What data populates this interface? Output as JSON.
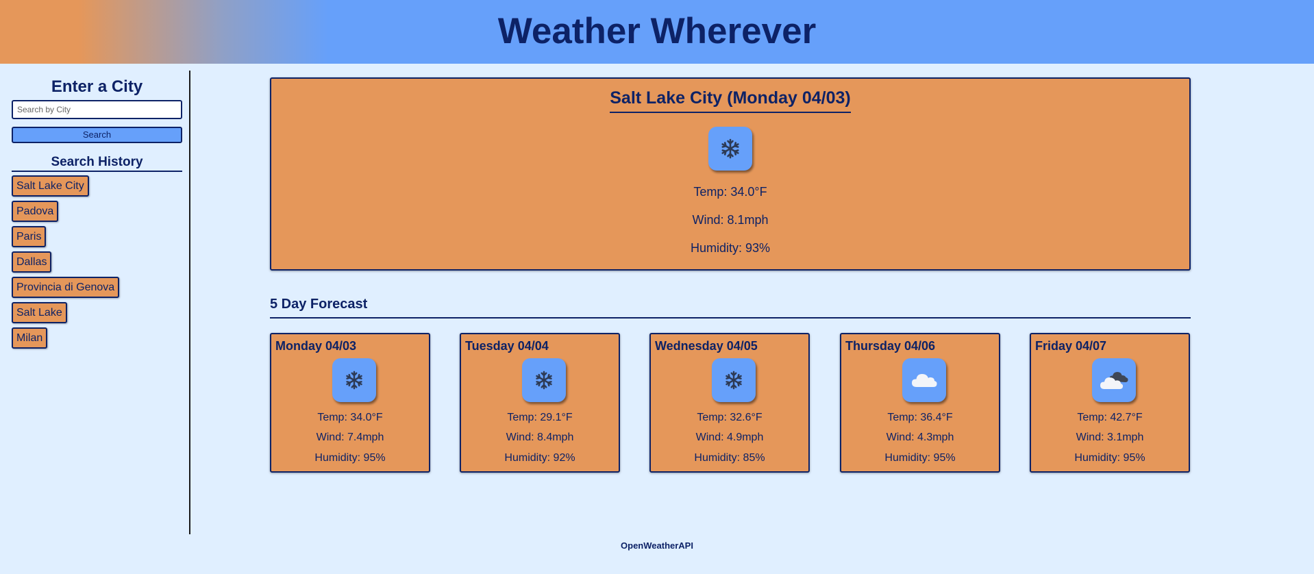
{
  "app": {
    "title": "Weather Wherever",
    "footer": "OpenWeatherAPI",
    "colors": {
      "accent_orange": "#e5975a",
      "accent_blue": "#66a0fa",
      "text_navy": "#0d2266",
      "background": "#e0efff"
    }
  },
  "sidebar": {
    "title": "Enter a City",
    "search_placeholder": "Search by City",
    "search_value": "",
    "search_button": "Search",
    "history_title": "Search History",
    "history": [
      "Salt Lake City",
      "Padova",
      "Paris",
      "Dallas",
      "Provincia di Genova",
      "Salt Lake",
      "Milan"
    ]
  },
  "current": {
    "title": "Salt Lake City (Monday 04/03)",
    "icon": "snowflake-icon",
    "temp": "Temp: 34.0°F",
    "wind": "Wind: 8.1mph",
    "humidity": "Humidity: 93%"
  },
  "forecast": {
    "title": "5 Day Forecast",
    "days": [
      {
        "day": "Monday 04/03",
        "icon": "snowflake-icon",
        "temp": "Temp: 34.0°F",
        "wind": "Wind: 7.4mph",
        "humidity": "Humidity: 95%"
      },
      {
        "day": "Tuesday 04/04",
        "icon": "snowflake-icon",
        "temp": "Temp: 29.1°F",
        "wind": "Wind: 8.4mph",
        "humidity": "Humidity: 92%"
      },
      {
        "day": "Wednesday 04/05",
        "icon": "snowflake-icon",
        "temp": "Temp: 32.6°F",
        "wind": "Wind: 4.9mph",
        "humidity": "Humidity: 85%"
      },
      {
        "day": "Thursday 04/06",
        "icon": "cloud-icon",
        "temp": "Temp: 36.4°F",
        "wind": "Wind: 4.3mph",
        "humidity": "Humidity: 95%"
      },
      {
        "day": "Friday 04/07",
        "icon": "broken-clouds-icon",
        "temp": "Temp: 42.7°F",
        "wind": "Wind: 3.1mph",
        "humidity": "Humidity: 95%"
      }
    ]
  }
}
